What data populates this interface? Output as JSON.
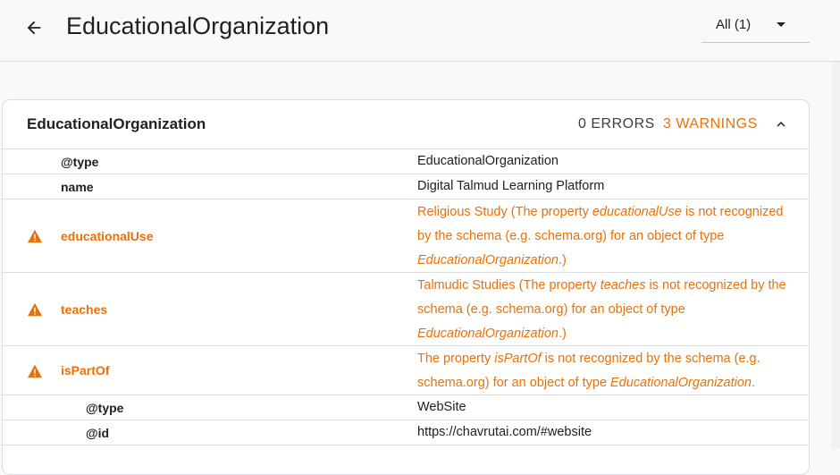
{
  "header": {
    "title": "EducationalOrganization",
    "filter_label": "All (1)"
  },
  "card": {
    "title": "EducationalOrganization",
    "errors_label": "0 ERRORS",
    "warnings_label": "3 WARNINGS"
  },
  "rows": [
    {
      "property": "@type",
      "value": "EducationalOrganization"
    },
    {
      "property": "name",
      "value": "Digital Talmud Learning Platform"
    },
    {
      "property": "educationalUse",
      "value_prefix": "Religious Study (The property ",
      "value_em1": "educationalUse",
      "value_mid": " is not recognized by the schema (e.g. schema.org) for an object of type ",
      "value_em2": "EducationalOrganization",
      "value_suffix": ".)"
    },
    {
      "property": "teaches",
      "value_prefix": "Talmudic Studies (The property ",
      "value_em1": "teaches",
      "value_mid": " is not recognized by the schema (e.g. schema.org) for an object of type ",
      "value_em2": "EducationalOrganization",
      "value_suffix": ".)"
    },
    {
      "property": "isPartOf",
      "value_prefix": "The property ",
      "value_em1": "isPartOf",
      "value_mid": " is not recognized by the schema (e.g. schema.org) for an object of type ",
      "value_em2": "EducationalOrganization",
      "value_suffix": "."
    },
    {
      "property": "@type",
      "value": "WebSite"
    },
    {
      "property": "@id",
      "value": "https://chavrutai.com/#website"
    }
  ],
  "colors": {
    "warning": "#e8710a",
    "text": "#202124",
    "divider": "#dadce0"
  },
  "icons": {
    "back": "arrow-back-icon",
    "filter": "caret-down-icon",
    "collapse": "chevron-up-icon",
    "warning": "warning-triangle-icon"
  }
}
